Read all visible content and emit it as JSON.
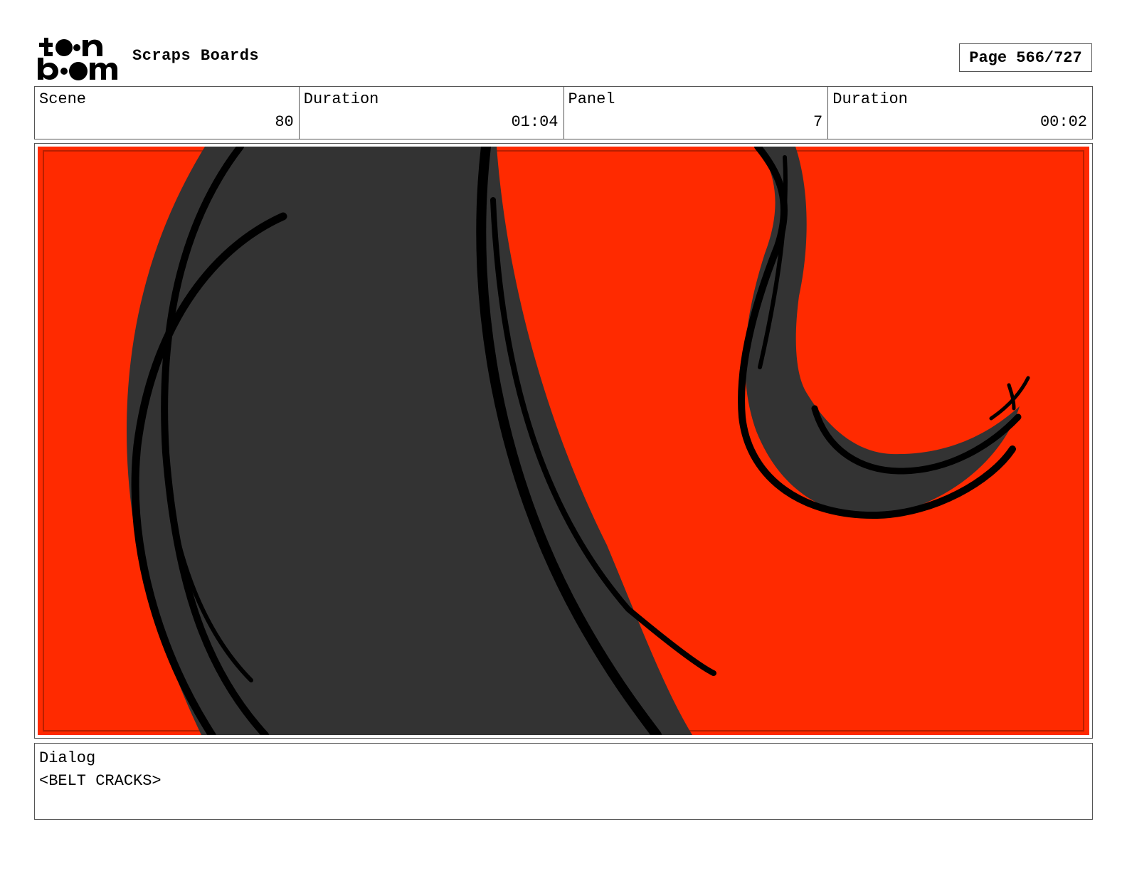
{
  "header": {
    "logo_icon": "toon-boom-logo-icon",
    "logo_text": "toon boom",
    "title": "Scraps Boards",
    "page_label": "Page 566/727"
  },
  "info": {
    "scene_label": "Scene",
    "scene_value": "80",
    "scene_duration_label": "Duration",
    "scene_duration_value": "01:04",
    "panel_label": "Panel",
    "panel_value": "7",
    "panel_duration_label": "Duration",
    "panel_duration_value": "00:02"
  },
  "panel": {
    "image_icon": "storyboard-panel-drawing",
    "background_color": "#ff2a00",
    "shape_color": "#333333",
    "line_color": "#000000"
  },
  "dialog": {
    "label": "Dialog",
    "text": "<BELT CRACKS>"
  }
}
